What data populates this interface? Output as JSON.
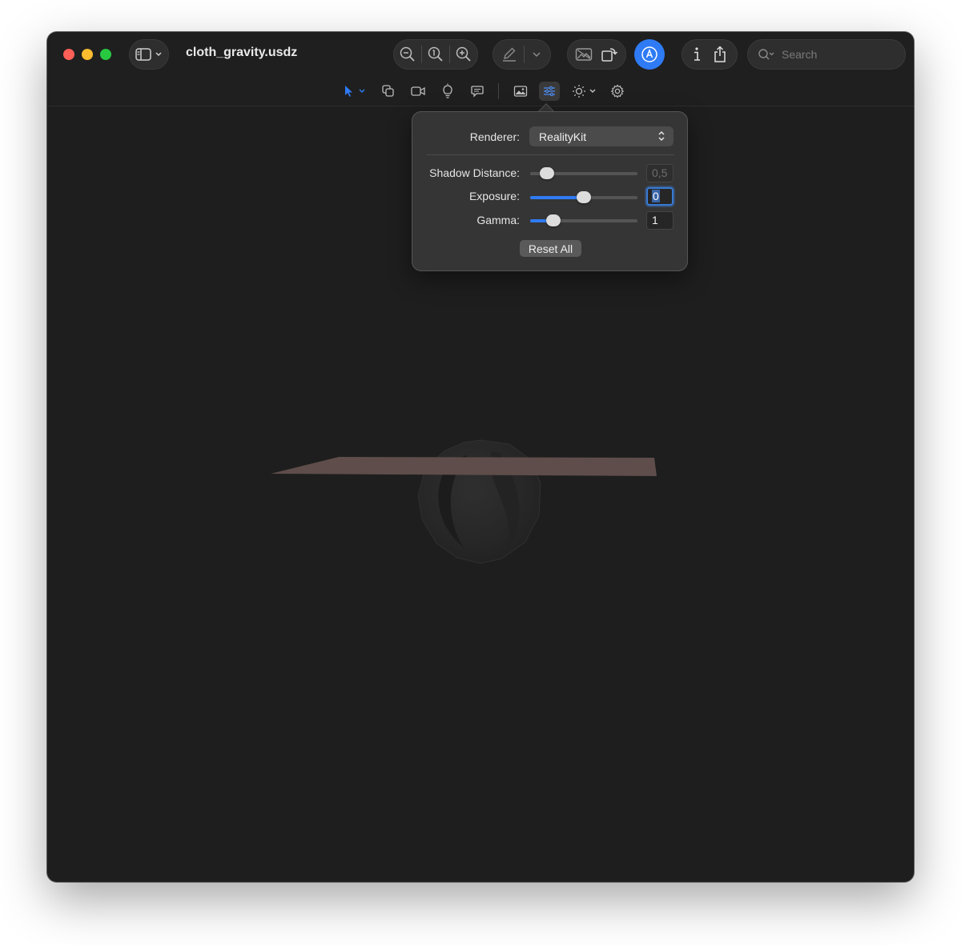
{
  "window": {
    "title": "cloth_gravity.usdz"
  },
  "toolbar": {
    "search_placeholder": "Search"
  },
  "popover": {
    "renderer_label": "Renderer:",
    "renderer_value": "RealityKit",
    "shadow_distance_label": "Shadow Distance:",
    "shadow_distance_value": "0,5",
    "shadow_distance_level": 0.16,
    "exposure_label": "Exposure:",
    "exposure_value": "0",
    "exposure_level": 0.5,
    "gamma_label": "Gamma:",
    "gamma_value": "1",
    "gamma_level": 0.22,
    "reset_label": "Reset All"
  },
  "colors": {
    "accent": "#2f7bf5",
    "window_bg": "#1e1e1e",
    "cloth": "#5e4d4a",
    "sphere": "#2a2a2a"
  },
  "icons": {
    "sidebar": "sidebar-toggle-icon",
    "zoom_out": "zoom-out-icon",
    "actual_size": "actual-size-icon",
    "zoom_in": "zoom-in-icon",
    "markup": "pencil-icon",
    "slideshow": "photo-icon",
    "rotate": "rotate-icon",
    "markup_toggle": "markup-circle-icon",
    "info": "info-icon",
    "share": "share-icon",
    "search": "search-icon"
  }
}
